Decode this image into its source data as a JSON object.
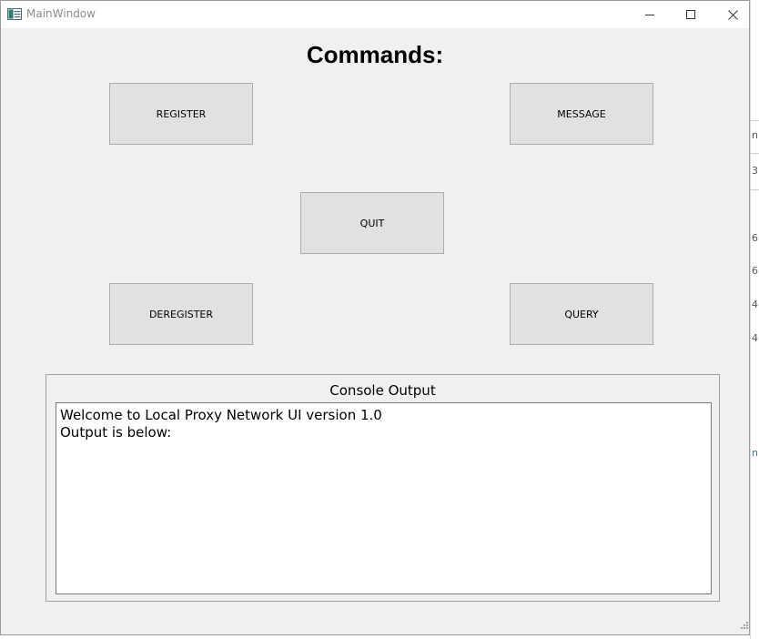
{
  "window": {
    "title": "MainWindow",
    "controls": {
      "minimize": "minimize-icon",
      "maximize": "maximize-icon",
      "close": "close-icon"
    }
  },
  "heading": "Commands:",
  "buttons": {
    "register": "REGISTER",
    "message": "MESSAGE",
    "quit": "QUIT",
    "deregister": "DEREGISTER",
    "query": "QUERY"
  },
  "console": {
    "title": "Console Output",
    "lines": [
      "Welcome to Local Proxy Network UI version 1.0",
      "Output is below:"
    ]
  },
  "background_window": {
    "glyphs": [
      "n",
      "3",
      "6",
      "6",
      "4",
      "4",
      "n"
    ]
  },
  "colors": {
    "window_bg": "#f0f0f0",
    "button_bg": "#e1e1e1",
    "button_border": "#adadad",
    "console_bg": "#ffffff"
  }
}
